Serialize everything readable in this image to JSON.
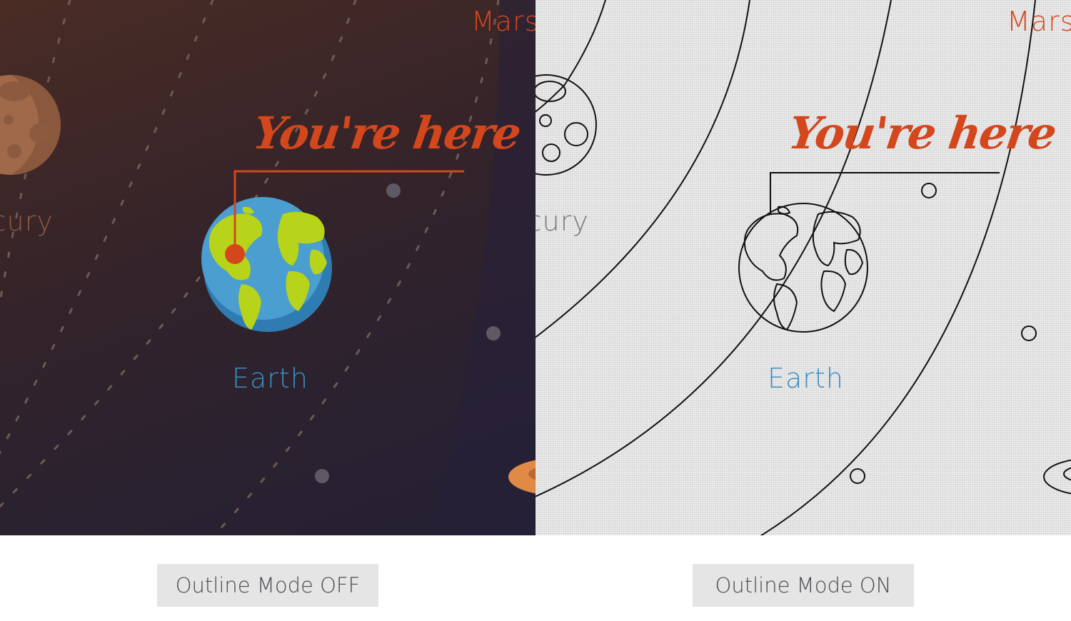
{
  "planets": {
    "mars": "Mars",
    "mercury": "rcury",
    "earth": "Earth"
  },
  "callout": "You're here",
  "buttons": {
    "off_label": "Outline Mode OFF",
    "on_label": "Outline Mode ON"
  },
  "colors": {
    "accent": "#d4461c",
    "earth_label": "#3a8fc0"
  }
}
